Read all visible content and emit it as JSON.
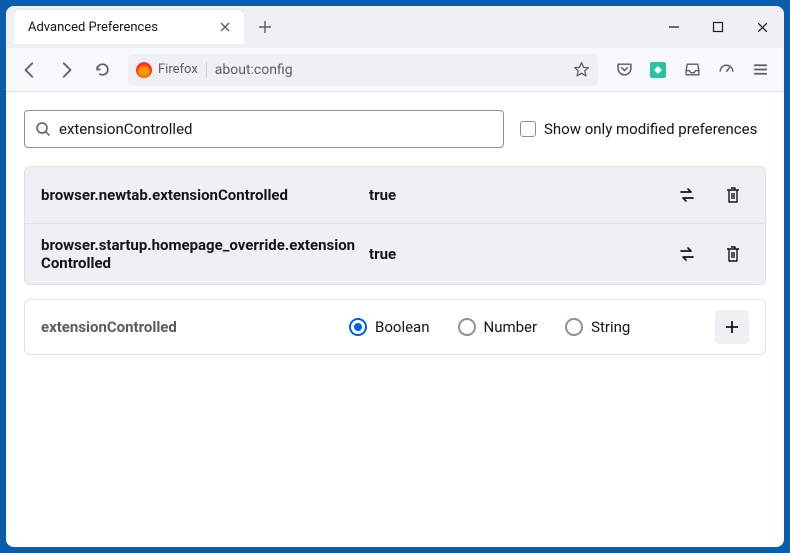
{
  "titlebar": {
    "tab_title": "Advanced Preferences"
  },
  "urlbar": {
    "identity": "Firefox",
    "url": "about:config"
  },
  "config": {
    "search_value": "extensionControlled",
    "show_modified_label": "Show only modified preferences",
    "rows": [
      {
        "name": "browser.newtab.extensionControlled",
        "value": "true"
      },
      {
        "name": "browser.startup.homepage_override.extensionControlled",
        "value": "true"
      }
    ],
    "add": {
      "name": "extensionControlled",
      "types": [
        "Boolean",
        "Number",
        "String"
      ],
      "selected": "Boolean"
    }
  }
}
